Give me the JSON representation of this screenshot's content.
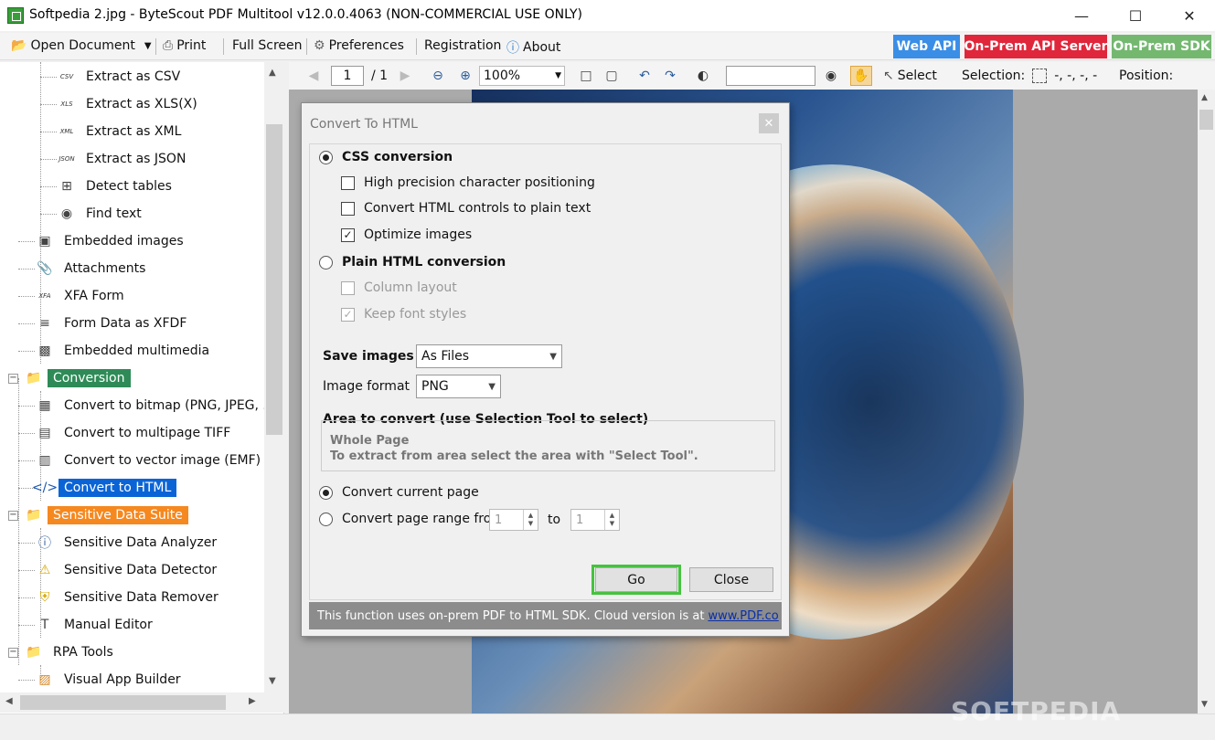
{
  "window": {
    "title": "Softpedia 2.jpg - ByteScout PDF Multitool v12.0.0.4063 (NON-COMMERCIAL USE ONLY)"
  },
  "menubar": {
    "open_document": "Open Document",
    "print": "Print",
    "full_screen": "Full Screen",
    "preferences": "Preferences",
    "registration": "Registration",
    "about": "About",
    "web_api": "Web API",
    "on_prem_api_server": "On-Prem API Server",
    "on_prem_sdk": "On-Prem SDK",
    "colors": {
      "web_api": "#3b8ee6",
      "on_prem_api_server": "#e0263b",
      "on_prem_sdk": "#74b870"
    }
  },
  "tree": {
    "items": [
      {
        "label": "Extract as CSV",
        "icon": "CSV"
      },
      {
        "label": "Extract as XLS(X)",
        "icon": "XLS"
      },
      {
        "label": "Extract as XML",
        "icon": "XML"
      },
      {
        "label": "Extract as JSON",
        "icon": "JSON"
      },
      {
        "label": "Detect tables",
        "icon": "table-icon"
      },
      {
        "label": "Find text",
        "icon": "binoculars-icon"
      },
      {
        "label": "Embedded images",
        "icon": "image-icon"
      },
      {
        "label": "Attachments",
        "icon": "paperclip-icon"
      },
      {
        "label": "XFA Form",
        "icon": "XFA"
      },
      {
        "label": "Form Data as XFDF",
        "icon": "form-icon"
      },
      {
        "label": "Embedded multimedia",
        "icon": "clapper-icon"
      },
      {
        "label": "Conversion",
        "icon": "folder-icon"
      },
      {
        "label": "Convert to bitmap (PNG, JPEG, ...",
        "icon": "bitmap-icon"
      },
      {
        "label": "Convert to multipage TIFF",
        "icon": "tiff-icon"
      },
      {
        "label": "Convert to vector image (EMF)",
        "icon": "vector-icon"
      },
      {
        "label": "Convert to HTML",
        "icon": "html-icon"
      },
      {
        "label": "Sensitive Data Suite",
        "icon": "folder-icon"
      },
      {
        "label": "Sensitive Data Analyzer",
        "icon": "info-icon"
      },
      {
        "label": "Sensitive Data Detector",
        "icon": "warning-icon"
      },
      {
        "label": "Sensitive Data Remover",
        "icon": "shield-icon"
      },
      {
        "label": "Manual Editor",
        "icon": "text-edit-icon"
      },
      {
        "label": "RPA Tools",
        "icon": "folder-icon"
      },
      {
        "label": "Visual App Builder",
        "icon": "cube-icon"
      }
    ],
    "colors": {
      "conversion": "#2e8b57",
      "selected": "#0a64d6",
      "sensitive": "#f5881f"
    }
  },
  "doctoolbar": {
    "page_current": "1",
    "page_total": "/ 1",
    "zoom": "100%",
    "select": "Select",
    "selection_label": "Selection:",
    "selection_value": "-, -, -, -",
    "position_label": "Position:"
  },
  "dialog": {
    "title": "Convert To HTML",
    "css_conversion": "CSS conversion",
    "high_precision": "High precision character positioning",
    "convert_controls": "Convert HTML controls to plain text",
    "optimize_images": "Optimize images",
    "plain_conversion": "Plain HTML conversion",
    "column_layout": "Column layout",
    "keep_font_styles": "Keep font styles",
    "save_images_label": "Save images",
    "save_images_value": "As Files",
    "image_format_label": "Image format",
    "image_format_value": "PNG",
    "area_title": "Area to convert (use Selection Tool to select)",
    "area_whole": "Whole Page",
    "area_hint": "To extract from area select the area with \"Select Tool\".",
    "convert_current": "Convert current page",
    "convert_range": "Convert page range from",
    "range_from": "1",
    "range_to_label": "to",
    "range_to": "1",
    "go": "Go",
    "close": "Close",
    "footer_text": "This function uses on-prem PDF to HTML SDK. Cloud version is at",
    "footer_link": "www.PDF.co"
  },
  "watermark": "SOFTPEDIA"
}
